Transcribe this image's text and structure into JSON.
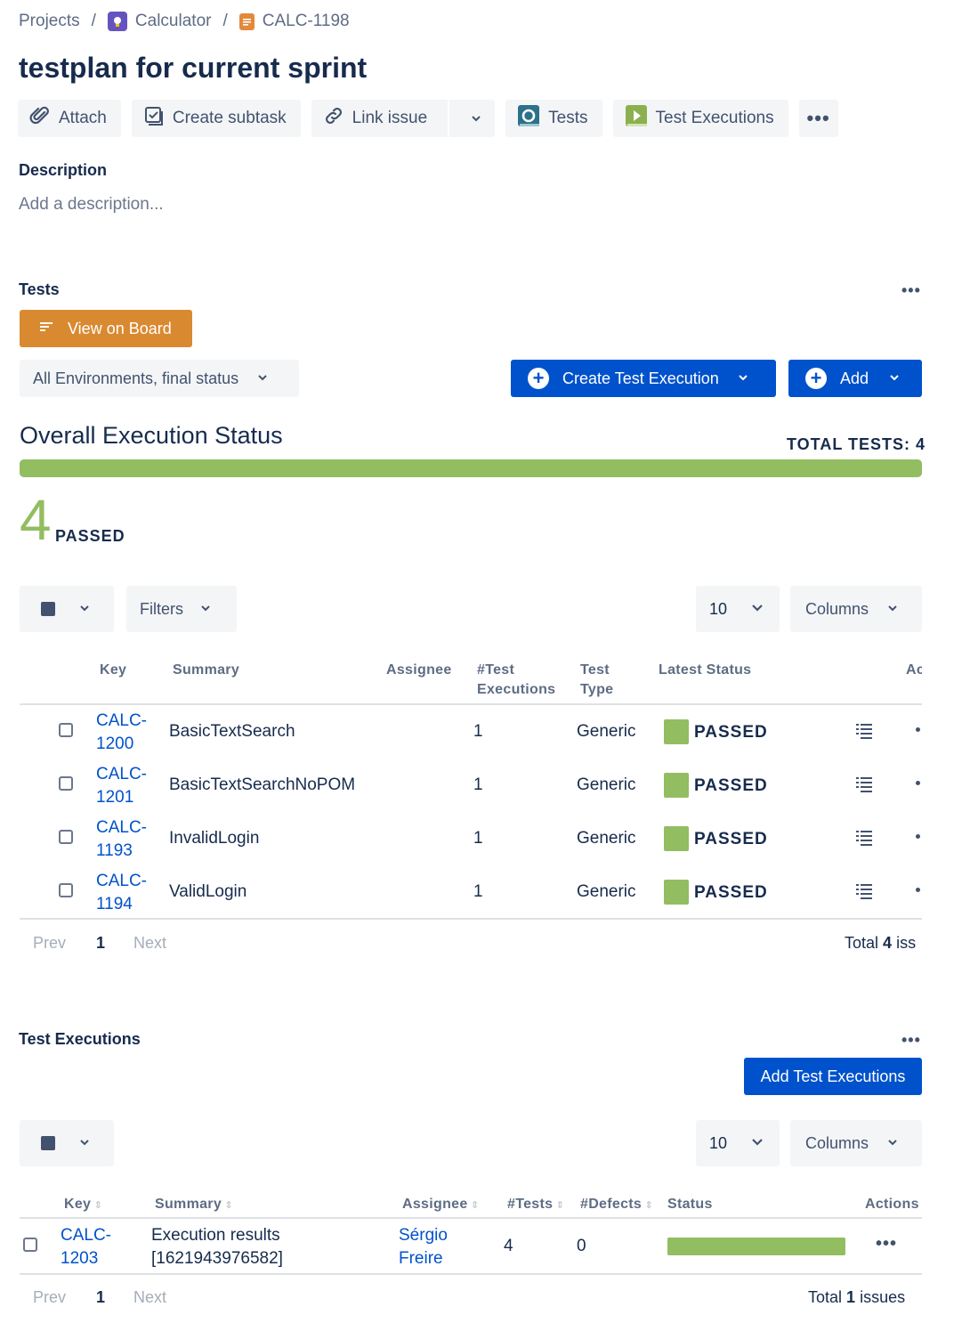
{
  "breadcrumb": {
    "projects": "Projects",
    "project": "Calculator",
    "issue_key": "CALC-1198"
  },
  "title": "testplan for current sprint",
  "toolbar": {
    "attach": "Attach",
    "create_subtask": "Create subtask",
    "link_issue": "Link issue",
    "tests": "Tests",
    "test_executions": "Test Executions"
  },
  "description": {
    "heading": "Description",
    "placeholder": "Add a description..."
  },
  "tests_section": {
    "heading": "Tests",
    "view_on_board": "View on Board",
    "env_filter": "All Environments, final status",
    "create_exec": "Create Test Execution",
    "add": "Add",
    "overall_title": "Overall Execution Status",
    "total_tests": "TOTAL TESTS: 4",
    "passed_count": "4",
    "passed_label": "PASSED",
    "passed_fraction": 1.0,
    "filters": "Filters",
    "page_size": "10",
    "columns": "Columns",
    "headers": {
      "key": "Key",
      "summary": "Summary",
      "assignee": "Assignee",
      "executions_1": "#Test",
      "executions_2": "Executions",
      "type_1": "Test",
      "type_2": "Type",
      "latest_status": "Latest Status",
      "actions": "Ac"
    },
    "rows": [
      {
        "key_1": "CALC-",
        "key_2": "1200",
        "summary": "BasicTextSearch",
        "executions": "1",
        "type": "Generic",
        "status": "PASSED"
      },
      {
        "key_1": "CALC-",
        "key_2": "1201",
        "summary": "BasicTextSearchNoPOM",
        "executions": "1",
        "type": "Generic",
        "status": "PASSED"
      },
      {
        "key_1": "CALC-",
        "key_2": "1193",
        "summary": "InvalidLogin",
        "executions": "1",
        "type": "Generic",
        "status": "PASSED"
      },
      {
        "key_1": "CALC-",
        "key_2": "1194",
        "summary": "ValidLogin",
        "executions": "1",
        "type": "Generic",
        "status": "PASSED"
      }
    ],
    "pager": {
      "prev": "Prev",
      "page": "1",
      "next": "Next",
      "total_prefix": "Total",
      "total_count": "4",
      "total_suffix": "iss"
    }
  },
  "executions_section": {
    "heading": "Test Executions",
    "add_button": "Add Test Executions",
    "page_size": "10",
    "columns": "Columns",
    "headers": {
      "key": "Key",
      "summary": "Summary",
      "assignee": "Assignee",
      "tests": "#Tests",
      "defects": "#Defects",
      "status": "Status",
      "actions": "Actions"
    },
    "rows": [
      {
        "key_1": "CALC-",
        "key_2": "1203",
        "summary_1": "Execution results",
        "summary_2": "[1621943976582]",
        "assignee_1": "Sérgio",
        "assignee_2": "Freire",
        "tests": "4",
        "defects": "0",
        "passed_fraction": 1.0
      }
    ],
    "pager": {
      "prev": "Prev",
      "page": "1",
      "next": "Next",
      "total_prefix": "Total",
      "total_count": "1",
      "total_suffix": "issues"
    }
  },
  "colors": {
    "passed": "#93BD61",
    "primary": "#0052CC",
    "board_button": "#D98A31",
    "link": "#0052CC"
  }
}
